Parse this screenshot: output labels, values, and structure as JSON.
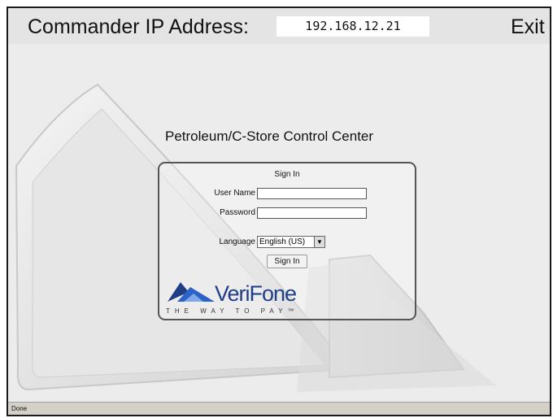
{
  "header": {
    "ip_label": "Commander IP Address:",
    "ip_value": "192.168.12.21",
    "exit_label": "Exit"
  },
  "app_title": "Petroleum/C-Store Control Center",
  "signin": {
    "heading": "Sign In",
    "username_label": "User Name",
    "username_value": "",
    "password_label": "Password",
    "password_value": "",
    "language_label": "Language",
    "language_selected": "English (US)",
    "button_label": "Sign In"
  },
  "logo": {
    "wordmark": "VeriFone",
    "tagline": "THE WAY TO PAY™"
  },
  "status": {
    "text": "Done"
  },
  "colors": {
    "frame_bg": "#ececec",
    "header_bg": "#e4e4e4",
    "logo_blue": "#1f3e86",
    "status_bg": "#d4d0c8"
  }
}
